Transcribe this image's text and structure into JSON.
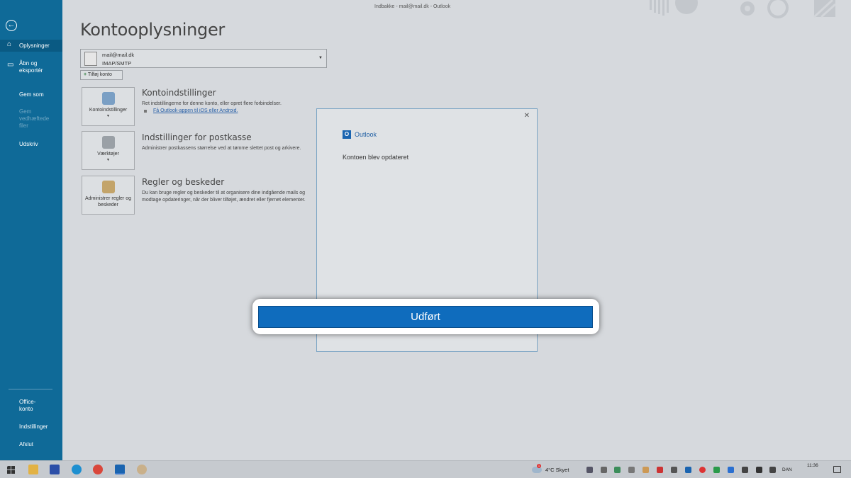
{
  "window": {
    "title": "Indbakke - mail@mail.dk  -  Outlook"
  },
  "sidebar": {
    "items": [
      {
        "label": "Oplysninger",
        "icon": "home-icon",
        "active": true
      },
      {
        "label": "Åbn og eksportér",
        "icon": "folder-open-icon"
      },
      {
        "label": "Gem som"
      },
      {
        "label": "Gem vedhæftede filer",
        "disabled": true
      },
      {
        "label": "Udskriv"
      },
      {
        "label": "Office-konto"
      },
      {
        "label": "Indstillinger"
      },
      {
        "label": "Afslut"
      }
    ]
  },
  "main": {
    "title": "Kontooplysninger",
    "account": {
      "email": "mail@mail.dk",
      "type": "IMAP/SMTP"
    },
    "add_account_label": "Tilføj konto",
    "sections": [
      {
        "tile_label": "Kontoindstillinger",
        "title": "Kontoindstillinger",
        "desc": "Ret indstillingerne for denne konto, eller opret flere forbindelser.",
        "link": "Få Outlook-appen til iOS eller Android."
      },
      {
        "tile_label": "Værktøjer",
        "title": "Indstillinger for postkasse",
        "desc": "Administrer postkassens størrelse ved at tømme slettet post og arkivere."
      },
      {
        "tile_label": "Administrer regler og beskeder",
        "title": "Regler og beskeder",
        "desc": "Du kan bruge regler og beskeder til at organisere dine indgående mails og modtage opdateringer, når der bliver tilføjet, ændret eller fjernet elementer."
      }
    ]
  },
  "dialog": {
    "app_name": "Outlook",
    "message": "Kontoen blev opdateret",
    "done_label": "Udført"
  },
  "taskbar": {
    "weather": "4°C  Skyet",
    "weather_badge": "1",
    "language": "DAN",
    "time": "11:36"
  },
  "colors": {
    "sidebar": "#0f6a98",
    "accent_button": "#0f6cbd",
    "link": "#2b62a8"
  }
}
